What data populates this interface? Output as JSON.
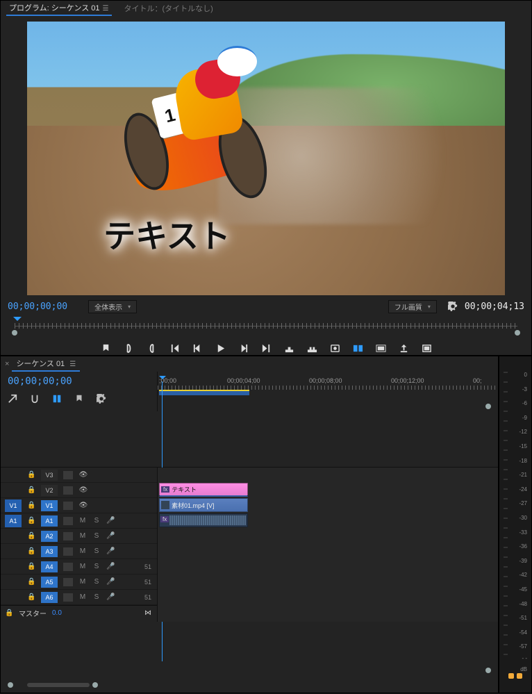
{
  "program": {
    "tab_active": "プログラム: シーケンス 01",
    "tab_inactive": "タイトル：(タイトルなし)",
    "overlay_text": "テキスト",
    "plate_number": "1",
    "timecode_left": "00;00;00;00",
    "timecode_right": "00;00;04;13",
    "zoom_select": "全体表示",
    "resolution_select": "フル画質"
  },
  "timeline": {
    "tab": "シーケンス 01",
    "timecode": "00;00;00;00",
    "ruler": [
      ";00;00",
      "00;00;04;00",
      "00;00;08;00",
      "00;00;12;00",
      "00;"
    ],
    "video_tracks": [
      {
        "src": "",
        "label": "V3"
      },
      {
        "src": "",
        "label": "V2"
      },
      {
        "src": "V1",
        "label": "V1"
      }
    ],
    "audio_tracks": [
      {
        "src": "A1",
        "label": "A1",
        "num": ""
      },
      {
        "src": "",
        "label": "A2",
        "num": ""
      },
      {
        "src": "",
        "label": "A3",
        "num": ""
      },
      {
        "src": "",
        "label": "A4",
        "num": "51"
      },
      {
        "src": "",
        "label": "A5",
        "num": "51"
      },
      {
        "src": "",
        "label": "A6",
        "num": "51"
      }
    ],
    "master_label": "マスター",
    "master_value": "0.0",
    "clip_text_label": "テキスト",
    "clip_video_label": "素材01.mp4 [V]"
  },
  "meter": {
    "scale": [
      "0",
      "-3",
      "-6",
      "-9",
      "-12",
      "-15",
      "-18",
      "-21",
      "-24",
      "-27",
      "-30",
      "-33",
      "-36",
      "-39",
      "-42",
      "-45",
      "-48",
      "-51",
      "-54",
      "-57",
      "- -",
      "dB"
    ]
  }
}
